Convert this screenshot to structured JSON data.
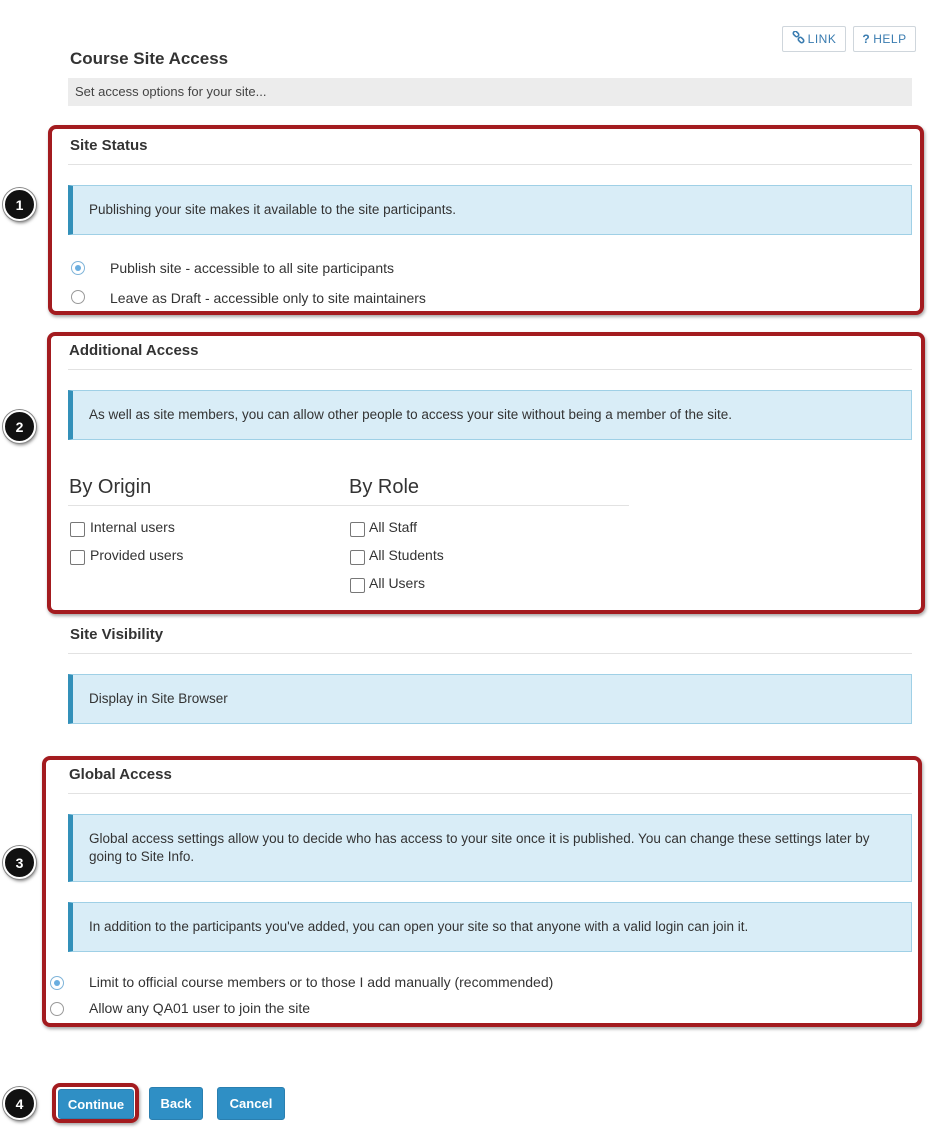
{
  "toolbar": {
    "link_label": "LINK",
    "help_label": "HELP",
    "help_icon": "?"
  },
  "page": {
    "title": "Course Site Access",
    "instructions": "Set access options for your site..."
  },
  "site_status": {
    "title": "Site Status",
    "info": "Publishing your site makes it available to the site participants.",
    "options": [
      {
        "label": "Publish site - accessible to all site participants",
        "selected": true
      },
      {
        "label": "Leave as Draft - accessible only to site maintainers",
        "selected": false
      }
    ]
  },
  "additional_access": {
    "title": "Additional Access",
    "info": "As well as site members, you can allow other people to access your site without being a member of the site.",
    "by_origin": {
      "heading": "By Origin",
      "options": [
        {
          "label": "Internal users",
          "checked": false
        },
        {
          "label": "Provided users",
          "checked": false
        }
      ]
    },
    "by_role": {
      "heading": "By Role",
      "options": [
        {
          "label": "All Staff",
          "checked": false
        },
        {
          "label": "All Students",
          "checked": false
        },
        {
          "label": "All Users",
          "checked": false
        }
      ]
    }
  },
  "site_visibility": {
    "title": "Site Visibility",
    "info": "Display in Site Browser"
  },
  "global_access": {
    "title": "Global Access",
    "info1": "Global access settings allow you to decide who has access to your site once it is published. You can change these settings later by going to Site Info.",
    "info2": "In addition to the participants you've added, you can open your site so that anyone with a valid login can join it.",
    "options": [
      {
        "label": "Limit to official course members or to those I add manually (recommended)",
        "selected": true
      },
      {
        "label": "Allow any QA01 user to join the site",
        "selected": false
      }
    ]
  },
  "actions": {
    "continue": "Continue",
    "back": "Back",
    "cancel": "Cancel"
  },
  "callouts": [
    "1",
    "2",
    "3",
    "4"
  ],
  "colors": {
    "highlight_border": "#a31b1f",
    "info_bg": "#d9edf7",
    "info_accent": "#3390b9",
    "button_bg": "#2f8fc5"
  }
}
